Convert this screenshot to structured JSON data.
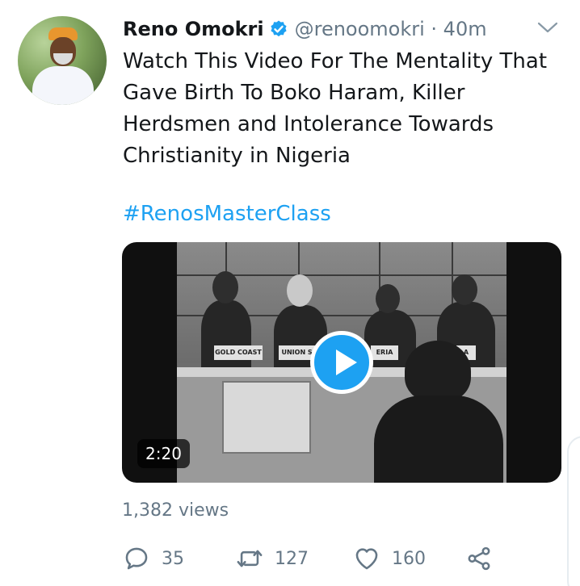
{
  "tweet": {
    "author_name": "Reno Omokri",
    "handle": "@renoomokri",
    "time": "40m",
    "handle_time": "@renoomokri · 40m",
    "text": "Watch This Video For The Mentality That Gave Birth To Boko Haram, Killer Herdsmen and Intolerance Towards Christianity in Nigeria",
    "hashtag": "#RenosMasterClass"
  },
  "media": {
    "type": "video",
    "duration": "2:20",
    "play_icon": "play-icon",
    "nameplates": [
      "GOLD COAST",
      "UNION SO",
      "ERIA",
      "A"
    ]
  },
  "stats": {
    "views": "1,382 views",
    "replies": "35",
    "retweets": "127",
    "likes": "160"
  },
  "icons": {
    "verified": "verified-badge-icon",
    "menu": "chevron-down-icon",
    "reply": "reply-icon",
    "retweet": "retweet-icon",
    "like": "heart-icon",
    "share": "share-icon"
  },
  "colors": {
    "accent": "#1da1f2",
    "text": "#14171a",
    "secondary": "#657786"
  }
}
